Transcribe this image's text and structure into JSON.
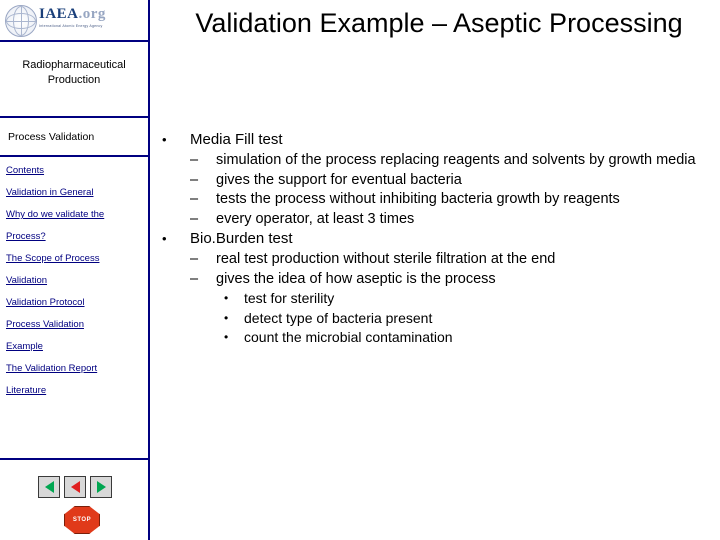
{
  "logo": {
    "name_main": "IAEA",
    "name_dim": ".org",
    "subtitle": "International Atomic Energy Agency"
  },
  "sidebar": {
    "course_title": "Radiopharmaceutical\nProduction",
    "section_heading": "Process Validation",
    "toc": [
      {
        "label": "Contents"
      },
      {
        "label": "Validation in General"
      },
      {
        "label": "Why do we validate the"
      },
      {
        "label": "Process?"
      },
      {
        "label": "The Scope of Process"
      },
      {
        "label": "Validation"
      },
      {
        "label": "Validation Protocol"
      },
      {
        "label": "Process Validation"
      },
      {
        "label": "Example"
      },
      {
        "label": "The Validation Report"
      },
      {
        "label": "Literature"
      }
    ],
    "nav": {
      "first_label": "first-slide",
      "prev_label": "previous-slide",
      "next_label": "next-slide",
      "stop_label": "STOP"
    }
  },
  "slide": {
    "title": "Validation Example – Aseptic Processing",
    "bullets": [
      {
        "level1": "Media Fill test",
        "children": [
          {
            "text": "simulation of the process replacing reagents and solvents by growth media",
            "children": []
          },
          {
            "text": "gives the support for eventual bacteria",
            "children": []
          },
          {
            "text": "tests the process without inhibiting bacteria growth by reagents",
            "children": []
          },
          {
            "text": "every operator, at least 3 times",
            "children": []
          }
        ]
      },
      {
        "level1": "Bio.Burden test",
        "children": [
          {
            "text": "real test production without sterile filtration at the end",
            "children": []
          },
          {
            "text": "gives the idea of how aseptic is the process",
            "children": [
              {
                "text": "test for sterility"
              },
              {
                "text": "detect type of bacteria present"
              },
              {
                "text": "count the microbial contamination"
              }
            ]
          }
        ]
      }
    ],
    "markers": {
      "dot": "•",
      "dash": "–"
    }
  },
  "colors": {
    "accent": "#000080",
    "link": "#000080",
    "stop": "#e03a1a",
    "nav_green": "#00a651",
    "nav_red": "#e02020"
  }
}
